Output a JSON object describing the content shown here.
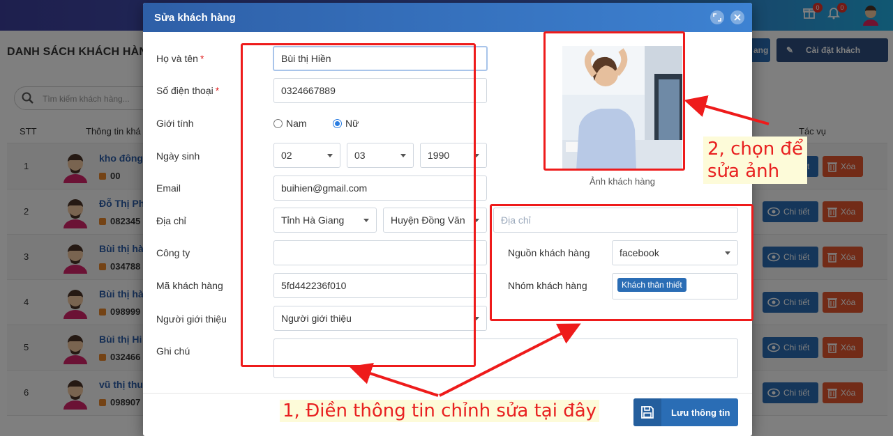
{
  "topbar": {
    "gift_badge": "0",
    "bell_badge": "0"
  },
  "page": {
    "title": "DANH SÁCH KHÁCH HÀN",
    "btn_short_label": "ang",
    "btn_settings_label": "Cài đặt khách hàng",
    "search_placeholder": "Tìm kiếm khách hàng...",
    "table_headers": {
      "stt": "STT",
      "info": "Thông tin khá",
      "actions": "Tác vụ"
    },
    "rows": [
      {
        "stt": "1",
        "name": "kho đông",
        "phone": "00"
      },
      {
        "stt": "2",
        "name": "Đỗ Thị Ph",
        "phone": "082345"
      },
      {
        "stt": "3",
        "name": "Bùi thị hà",
        "phone": "034788"
      },
      {
        "stt": "4",
        "name": "Bùi thị hà",
        "phone": "098999"
      },
      {
        "stt": "5",
        "name": "Bùi thị Hi",
        "phone": "032466"
      },
      {
        "stt": "6",
        "name": "vũ thị thu",
        "phone": "098907"
      }
    ],
    "detail_label": "Chi tiết",
    "delete_label": "Xóa"
  },
  "modal": {
    "title": "Sửa khách hàng",
    "labels": {
      "full_name": "Họ và tên",
      "phone": "Số điện thoại",
      "gender": "Giới tính",
      "birthday": "Ngày sinh",
      "email": "Email",
      "address": "Địa chỉ",
      "company": "Công ty",
      "customer_code": "Mã khách hàng",
      "referrer": "Người giới thiệu",
      "note": "Ghi chú",
      "source": "Nguồn khách hàng",
      "group": "Nhóm khách hàng"
    },
    "required_mark": "*",
    "values": {
      "full_name": "Bùi thị Hiền",
      "phone": "0324667889",
      "gender_male": "Nam",
      "gender_female": "Nữ",
      "gender_selected": "Nữ",
      "birth_day": "02",
      "birth_month": "03",
      "birth_year": "1990",
      "email": "buihien@gmail.com",
      "province": "Tỉnh Hà Giang",
      "district": "Huyện Đồng Văn",
      "address_placeholder": "Địa chỉ",
      "company": "",
      "customer_code": "5fd442236f010",
      "referrer_placeholder": "Người giới thiệu",
      "note": "",
      "source": "facebook",
      "group_tag": "Khách thân thiết"
    },
    "photo_caption": "Ảnh khách hàng",
    "save_label": "Lưu thông tin"
  },
  "annotations": {
    "step1": "1, Điền thông tin chỉnh sửa tại đây",
    "step2_line1": "2, chọn để",
    "step2_line2": "sửa ảnh"
  },
  "colors": {
    "primary": "#2a6db5",
    "danger": "#e4572e",
    "annotation": "#ee1b1b"
  }
}
